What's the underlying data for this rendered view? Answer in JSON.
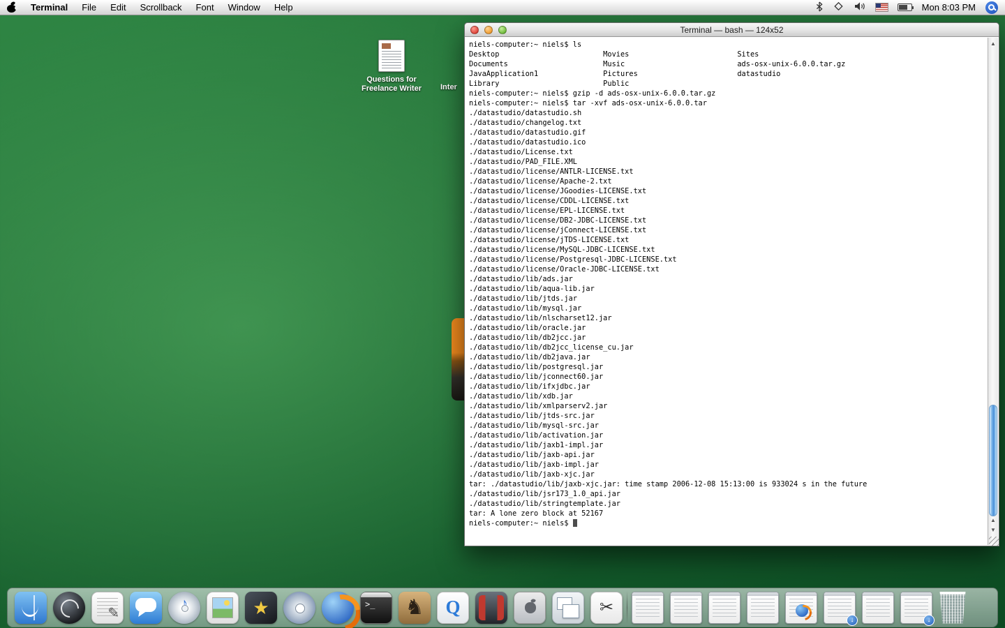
{
  "menu_bar": {
    "app_name": "Terminal",
    "menus": [
      "File",
      "Edit",
      "Scrollback",
      "Font",
      "Window",
      "Help"
    ],
    "clock": "Mon 8:03 PM",
    "status_icons": [
      "bluetooth-icon",
      "airport-icon",
      "volume-icon",
      "input-flag-icon",
      "battery-icon",
      "spotlight-icon"
    ]
  },
  "desktop": {
    "questions_icon": {
      "line1": "Questions for",
      "line2": "Freelance Writer"
    },
    "partial_icon_label": "Inter"
  },
  "terminal": {
    "title": "Terminal — bash — 124x52",
    "prompt": "niels-computer:~ niels$ ",
    "lines": [
      "niels-computer:~ niels$ ls",
      "Desktop                        Movies                         Sites",
      "Documents                      Music                          ads-osx-unix-6.0.0.tar.gz",
      "JavaApplication1               Pictures                       datastudio",
      "Library                        Public",
      "niels-computer:~ niels$ gzip -d ads-osx-unix-6.0.0.tar.gz",
      "niels-computer:~ niels$ tar -xvf ads-osx-unix-6.0.0.tar",
      "./datastudio/datastudio.sh",
      "./datastudio/changelog.txt",
      "./datastudio/datastudio.gif",
      "./datastudio/datastudio.ico",
      "./datastudio/License.txt",
      "./datastudio/PAD_FILE.XML",
      "./datastudio/license/ANTLR-LICENSE.txt",
      "./datastudio/license/Apache-2.txt",
      "./datastudio/license/JGoodies-LICENSE.txt",
      "./datastudio/license/CDDL-LICENSE.txt",
      "./datastudio/license/EPL-LICENSE.txt",
      "./datastudio/license/DB2-JDBC-LICENSE.txt",
      "./datastudio/license/jConnect-LICENSE.txt",
      "./datastudio/license/jTDS-LICENSE.txt",
      "./datastudio/license/MySQL-JDBC-LICENSE.txt",
      "./datastudio/license/Postgresql-JDBC-LICENSE.txt",
      "./datastudio/license/Oracle-JDBC-LICENSE.txt",
      "./datastudio/lib/ads.jar",
      "./datastudio/lib/aqua-lib.jar",
      "./datastudio/lib/jtds.jar",
      "./datastudio/lib/mysql.jar",
      "./datastudio/lib/nlscharset12.jar",
      "./datastudio/lib/oracle.jar",
      "./datastudio/lib/db2jcc.jar",
      "./datastudio/lib/db2jcc_license_cu.jar",
      "./datastudio/lib/db2java.jar",
      "./datastudio/lib/postgresql.jar",
      "./datastudio/lib/jconnect60.jar",
      "./datastudio/lib/ifxjdbc.jar",
      "./datastudio/lib/xdb.jar",
      "./datastudio/lib/xmlparserv2.jar",
      "./datastudio/lib/jtds-src.jar",
      "./datastudio/lib/mysql-src.jar",
      "./datastudio/lib/activation.jar",
      "./datastudio/lib/jaxb1-impl.jar",
      "./datastudio/lib/jaxb-api.jar",
      "./datastudio/lib/jaxb-impl.jar",
      "./datastudio/lib/jaxb-xjc.jar",
      "tar: ./datastudio/lib/jaxb-xjc.jar: time stamp 2006-12-08 15:13:00 is 933024 s in the future",
      "./datastudio/lib/jsr173_1.0_api.jar",
      "./datastudio/lib/stringtemplate.jar",
      "tar: A lone zero block at 52167"
    ]
  },
  "dock": {
    "badge_glyph": "↓",
    "apps": [
      {
        "name": "finder",
        "glyph": ""
      },
      {
        "name": "dashboard",
        "glyph": ""
      },
      {
        "name": "textedit",
        "glyph": "✎"
      },
      {
        "name": "ichat",
        "glyph": ""
      },
      {
        "name": "itunes",
        "glyph": "♪"
      },
      {
        "name": "iphoto",
        "glyph": ""
      },
      {
        "name": "imovie",
        "glyph": "★"
      },
      {
        "name": "dvd-player",
        "glyph": ""
      },
      {
        "name": "firefox",
        "glyph": ""
      },
      {
        "name": "terminal",
        "glyph": ">_"
      },
      {
        "name": "chess",
        "glyph": "♞"
      },
      {
        "name": "quicktime",
        "glyph": "Q"
      },
      {
        "name": "photo-booth",
        "glyph": ""
      },
      {
        "name": "mac-box",
        "glyph": ""
      },
      {
        "name": "expose",
        "glyph": ""
      },
      {
        "name": "cut",
        "glyph": "✂"
      }
    ],
    "minimized": [
      {
        "kind": "document"
      },
      {
        "kind": "document"
      },
      {
        "kind": "document"
      },
      {
        "kind": "document"
      },
      {
        "kind": "firefox-page"
      },
      {
        "kind": "document",
        "badge": true
      },
      {
        "kind": "document"
      },
      {
        "kind": "document",
        "badge": true
      }
    ]
  }
}
